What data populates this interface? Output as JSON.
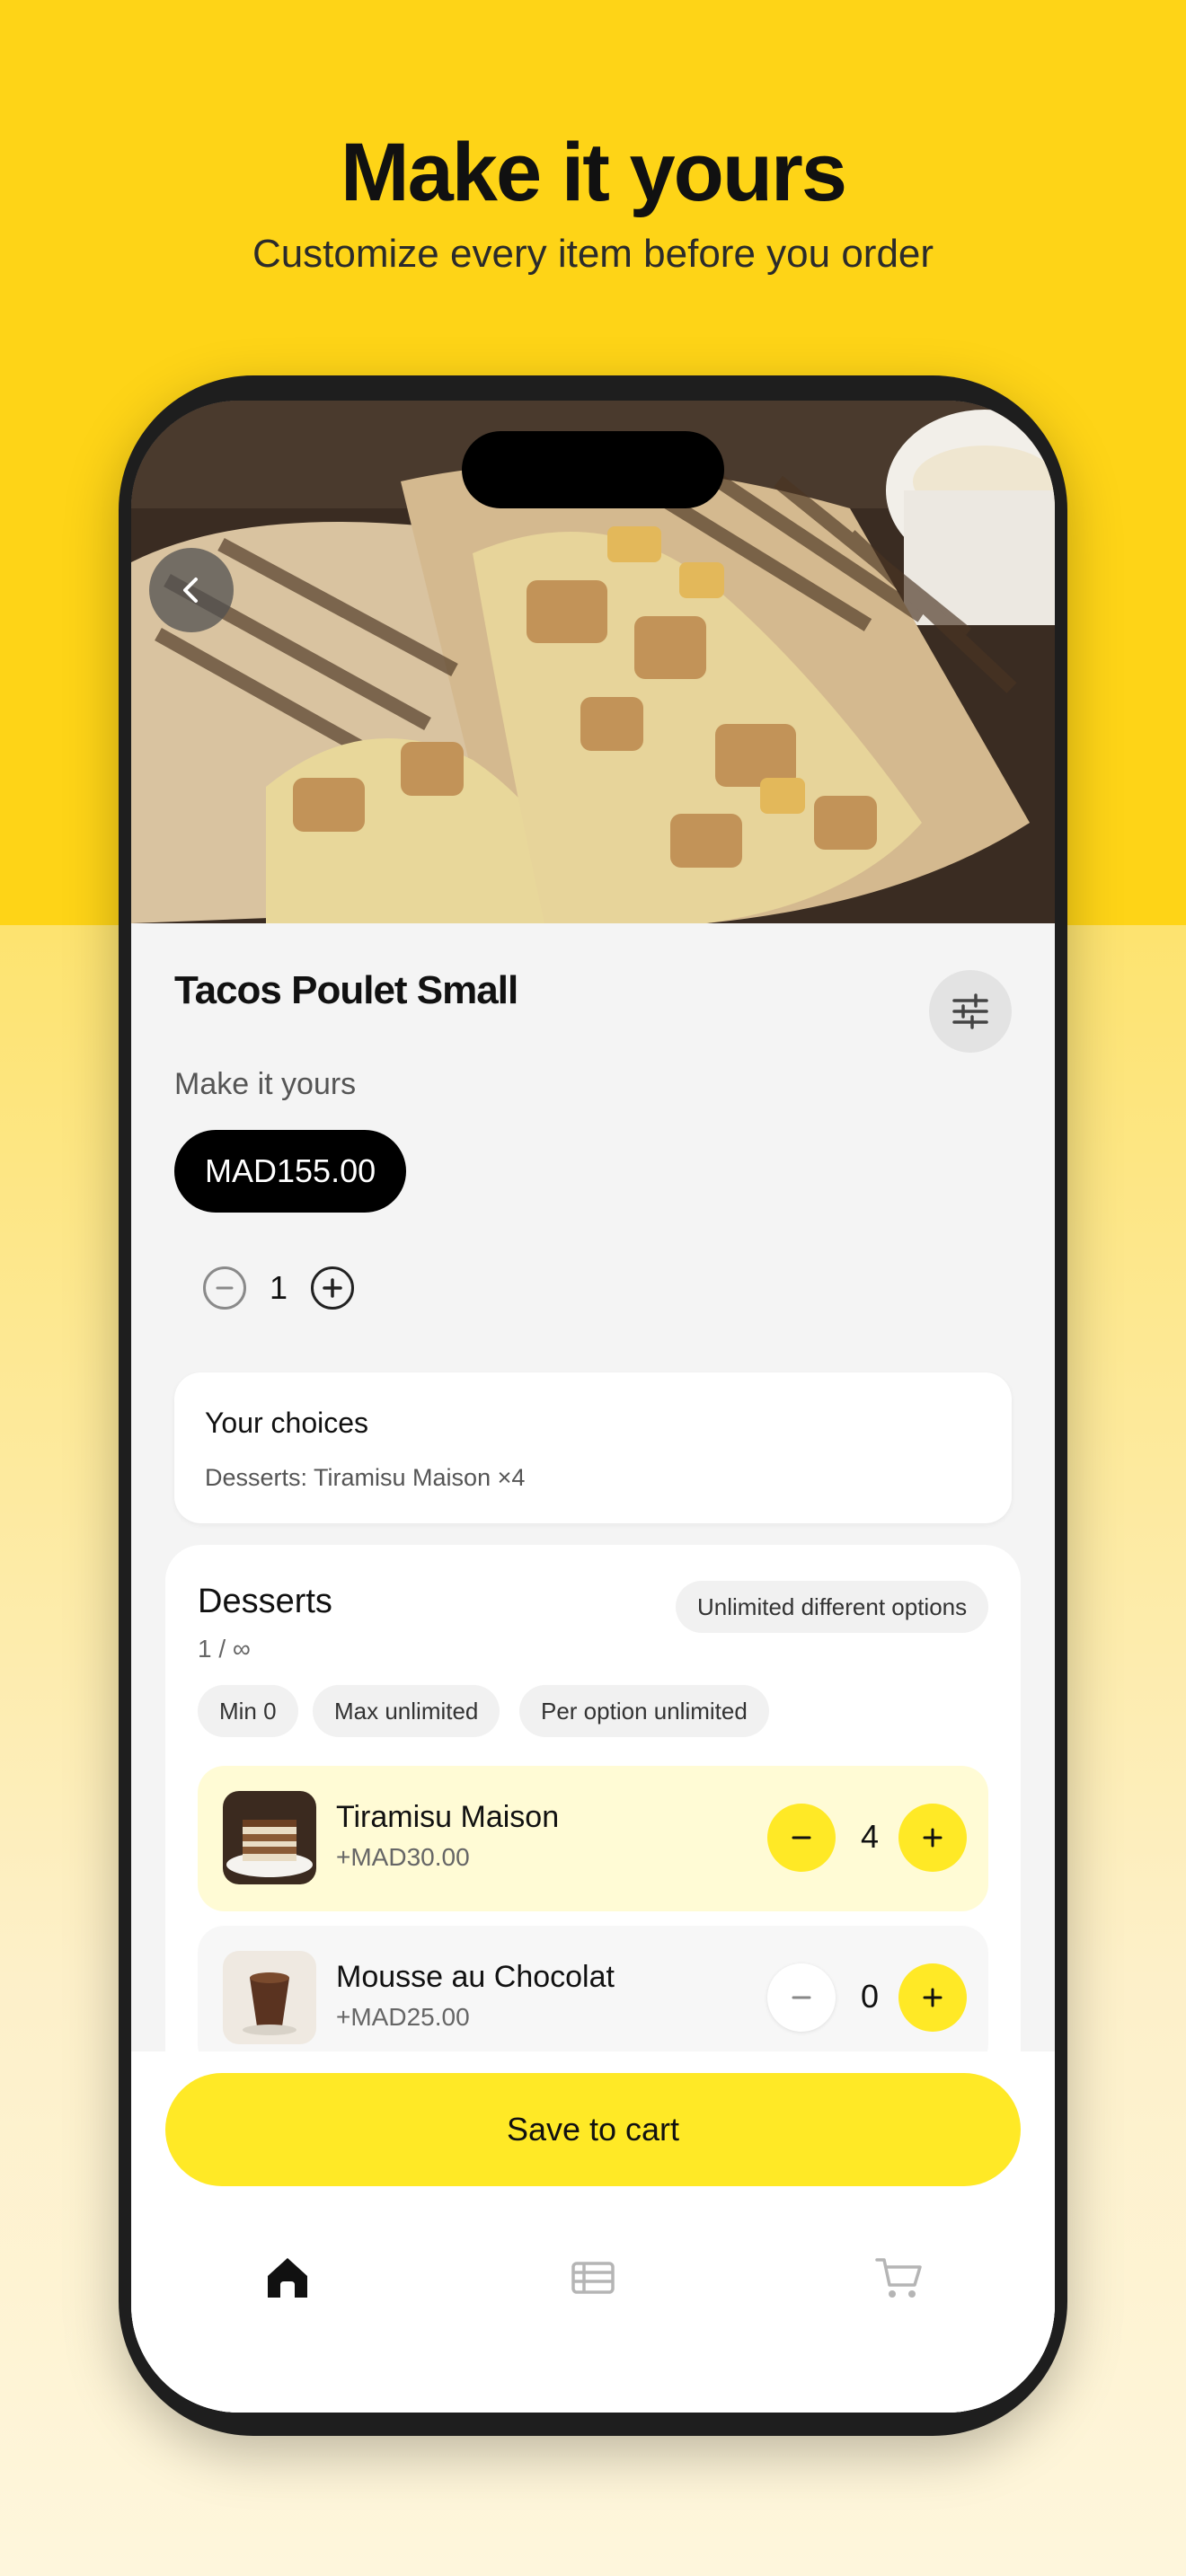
{
  "promo": {
    "headline": "Make it yours",
    "subline": "Customize every item before you order"
  },
  "product": {
    "title": "Tacos Poulet Small",
    "subtitle": "Make it yours",
    "price": "MAD155.00",
    "quantity": "1"
  },
  "choices": {
    "title": "Your choices",
    "detail": "Desserts: Tiramisu Maison ×4"
  },
  "desserts": {
    "title": "Desserts",
    "count": "1 / ∞",
    "badge": "Unlimited different options",
    "chips": [
      "Min 0",
      "Max unlimited",
      "Per option unlimited"
    ],
    "options": [
      {
        "name": "Tiramisu Maison",
        "price": "+MAD30.00",
        "qty": "4",
        "selected": true
      },
      {
        "name": "Mousse au Chocolat",
        "price": "+MAD25.00",
        "qty": "0",
        "selected": false
      }
    ]
  },
  "cart": {
    "save_label": "Save to cart"
  },
  "nav": {
    "items": [
      "home-icon",
      "menu-list-icon",
      "cart-icon"
    ],
    "active": "home-icon"
  },
  "colors": {
    "brand_yellow": "#fed417",
    "button_yellow": "#ffe926",
    "selected_row": "#fffbd5"
  }
}
